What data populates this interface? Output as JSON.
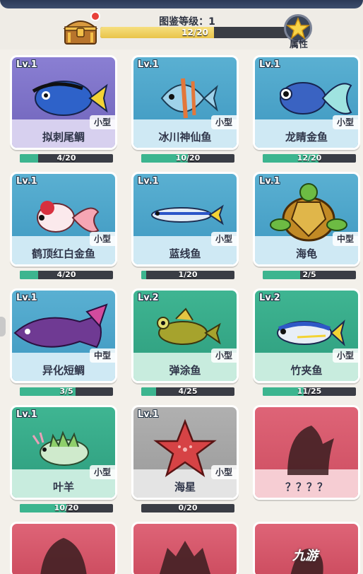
{
  "header": {
    "level_title": "图鉴等级：1",
    "level_progress_text": "12/20",
    "level_progress_fraction": 0.6,
    "attr_label": "属性",
    "chest_icon": "treasure-chest-icon",
    "star_icon": "star-icon"
  },
  "cards": [
    {
      "lv": "Lv.1",
      "name": "拟刺尾鲷",
      "size": "小型",
      "progress": "4/20",
      "fraction": 0.2,
      "theme": "purple",
      "icon": "tang-fish-icon"
    },
    {
      "lv": "Lv.1",
      "name": "冰川神仙鱼",
      "size": "小型",
      "progress": "10/20",
      "fraction": 0.5,
      "theme": "blue",
      "icon": "angelfish-icon"
    },
    {
      "lv": "Lv.1",
      "name": "龙睛金鱼",
      "size": "小型",
      "progress": "12/20",
      "fraction": 0.6,
      "theme": "blue",
      "icon": "telescope-goldfish-icon"
    },
    {
      "lv": "Lv.1",
      "name": "鹤顶红白金鱼",
      "size": "小型",
      "progress": "4/20",
      "fraction": 0.2,
      "theme": "blue",
      "icon": "redcap-goldfish-icon"
    },
    {
      "lv": "Lv.1",
      "name": "蓝线鱼",
      "size": "小型",
      "progress": "1/20",
      "fraction": 0.05,
      "theme": "blue",
      "icon": "blue-line-fish-icon"
    },
    {
      "lv": "Lv.1",
      "name": "海龟",
      "size": "中型",
      "progress": "2/5",
      "fraction": 0.4,
      "theme": "blue",
      "icon": "sea-turtle-icon"
    },
    {
      "lv": "Lv.1",
      "name": "异化短鲷",
      "size": "中型",
      "progress": "3/5",
      "fraction": 0.6,
      "theme": "blue",
      "icon": "cichlid-icon"
    },
    {
      "lv": "Lv.2",
      "name": "弹涂鱼",
      "size": "小型",
      "progress": "4/25",
      "fraction": 0.16,
      "theme": "green",
      "icon": "mudskipper-icon"
    },
    {
      "lv": "Lv.2",
      "name": "竹夹鱼",
      "size": "小型",
      "progress": "11/25",
      "fraction": 0.44,
      "theme": "green",
      "icon": "horse-mackerel-icon"
    },
    {
      "lv": "Lv.1",
      "name": "叶羊",
      "size": "小型",
      "progress": "10/20",
      "fraction": 0.5,
      "theme": "green",
      "icon": "leaf-sheep-icon"
    },
    {
      "lv": "Lv.1",
      "name": "海星",
      "size": "小型",
      "progress": "0/20",
      "fraction": 0.0,
      "theme": "gray",
      "icon": "starfish-icon"
    },
    {
      "lv": "",
      "name": "？？？？",
      "size": "",
      "progress": "",
      "fraction": 0,
      "theme": "red",
      "icon": "locked-silhouette-icon"
    }
  ],
  "watermark": "九游"
}
